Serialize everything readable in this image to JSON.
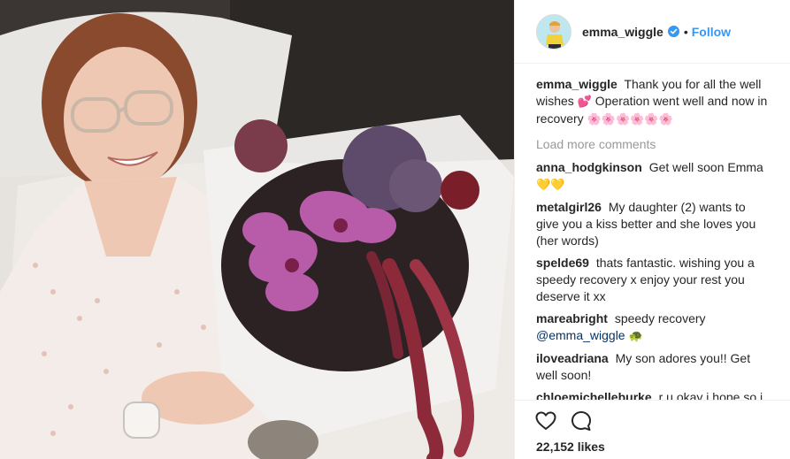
{
  "post": {
    "username": "emma_wiggle",
    "separator": "•",
    "follow_label": "Follow",
    "likes": "22,152 likes"
  },
  "caption": {
    "username": "emma_wiggle",
    "text_part1": "Thank you for all the well wishes",
    "emoji1": "💕",
    "text_part2": "Operation went well and now in recovery",
    "emoji2": "🌸🌸🌸🌸🌸🌸"
  },
  "load_more_label": "Load more comments",
  "comments": [
    {
      "username": "anna_hodgkinson",
      "text": "Get well soon Emma",
      "emoji": "💛💛"
    },
    {
      "username": "metalgirl26",
      "text": "My daughter (2) wants to give you a kiss better and she loves you (her words)"
    },
    {
      "username": "spelde69",
      "text": "thats fantastic. wishing you a speedy recovery x enjoy your rest you deserve it xx"
    },
    {
      "username": "mareabright",
      "text": "speedy recovery",
      "mention": "@emma_wiggle",
      "emoji": "🐢"
    },
    {
      "username": "iloveadriana",
      "text": "My son adores you!! Get well soon!"
    },
    {
      "username": "chloemichelleburke",
      "text": "r u okay i hope so i may not know u personally but i do care"
    }
  ],
  "icons": {
    "verified": "verified-badge-icon",
    "like": "heart-icon",
    "comment": "comment-bubble-icon"
  },
  "colors": {
    "link_blue": "#3897f0",
    "mention_blue": "#003569",
    "muted_gray": "#999999",
    "divider": "#efefef"
  }
}
